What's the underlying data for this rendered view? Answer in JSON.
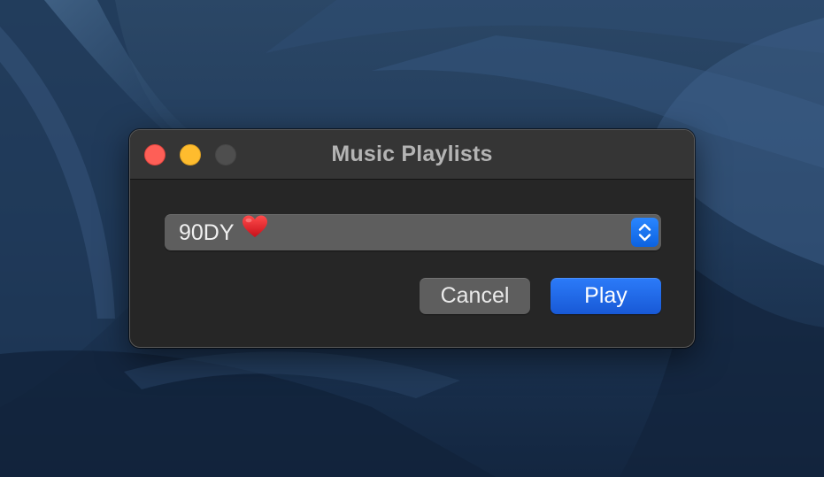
{
  "window": {
    "title": "Music Playlists"
  },
  "traffic_lights": {
    "close_color": "#fe5f57",
    "minimize_color": "#febc2e",
    "zoom_color": "#4e4e4e"
  },
  "playlist_popup": {
    "selected_value": "90DY",
    "icon": "heart-icon",
    "stepper_icon": "up-down-chevron-icon"
  },
  "buttons": {
    "cancel_label": "Cancel",
    "play_label": "Play"
  },
  "colors": {
    "accent": "#1a6cf0",
    "desktop_background": "#1c3150",
    "window_background": "#262626"
  }
}
